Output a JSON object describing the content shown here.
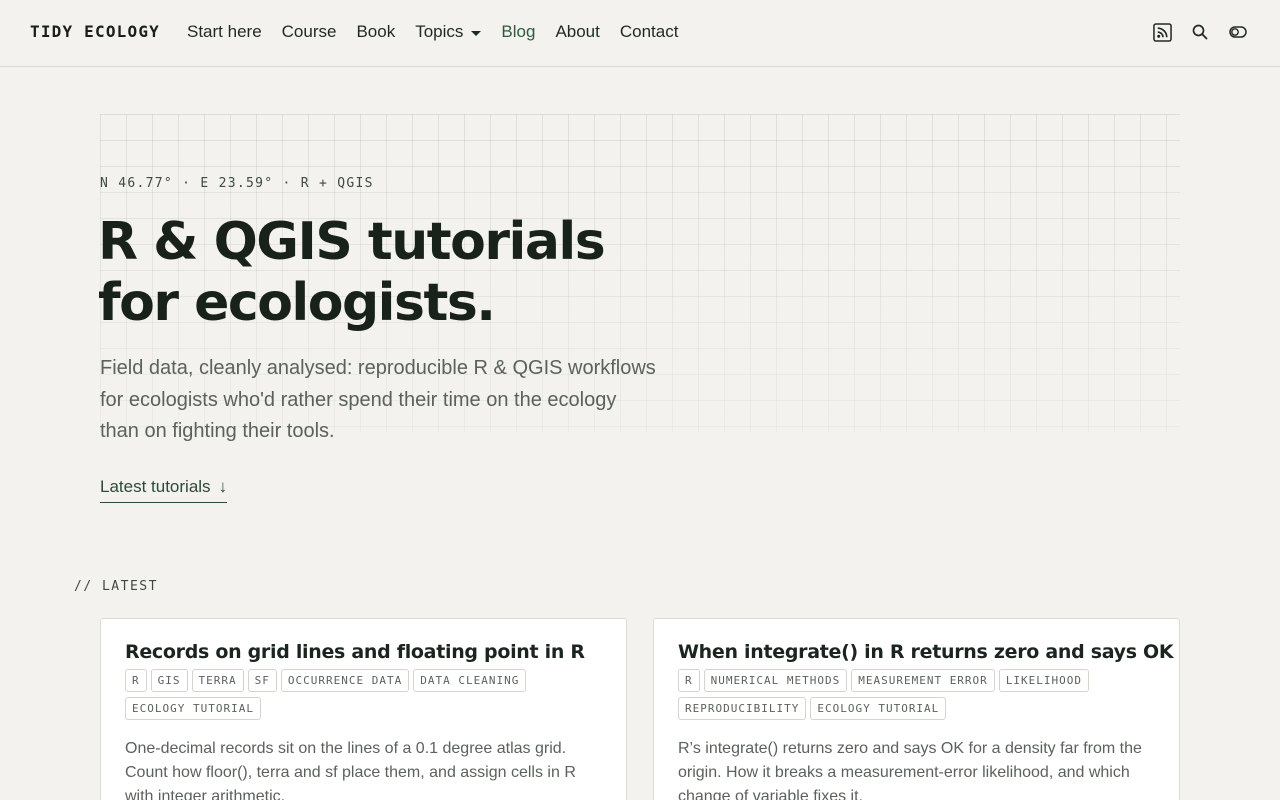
{
  "header": {
    "brand": "TIDY ECOLOGY",
    "nav": [
      {
        "label": "Start here",
        "active": false
      },
      {
        "label": "Course",
        "active": false
      },
      {
        "label": "Book",
        "active": false
      },
      {
        "label": "Topics",
        "active": false,
        "dropdown": true
      },
      {
        "label": "Blog",
        "active": true
      },
      {
        "label": "About",
        "active": false
      },
      {
        "label": "Contact",
        "active": false
      }
    ],
    "icons": [
      "rss-icon",
      "search-icon",
      "theme-toggle-icon"
    ]
  },
  "hero": {
    "coords": "N 46.77° · E 23.59° · R + QGIS",
    "title_line1": "R & QGIS tutorials",
    "title_line2": "for ecologists.",
    "subtitle": "Field data, cleanly analysed: reproducible R & QGIS workflows for ecologists who'd rather spend their time on the ecology than on fighting their tools.",
    "cta_label": "Latest tutorials",
    "cta_arrow": "↓"
  },
  "latest": {
    "label": "// LATEST",
    "cards": [
      {
        "title": "Records on grid lines and floating point in R",
        "tags": [
          "R",
          "GIS",
          "TERRA",
          "SF",
          "OCCURRENCE DATA",
          "DATA CLEANING",
          "ECOLOGY TUTORIAL"
        ],
        "excerpt": "One-decimal records sit on the lines of a 0.1 degree atlas grid. Count how floor(), terra and sf place them, and assign cells in R with integer arithmetic."
      },
      {
        "title": "When integrate() in R returns zero and says OK",
        "tags": [
          "R",
          "NUMERICAL METHODS",
          "MEASUREMENT ERROR",
          "LIKELIHOOD",
          "REPRODUCIBILITY",
          "ECOLOGY TUTORIAL"
        ],
        "excerpt": "R’s integrate() returns zero and says OK for a density far from the origin. How it breaks a measurement-error likelihood, and which change of variable fixes it."
      }
    ]
  },
  "colors": {
    "background": "#f3f2ee",
    "accent": "#2f5a3e",
    "text": "#1c2620",
    "muted": "#5a625c"
  }
}
